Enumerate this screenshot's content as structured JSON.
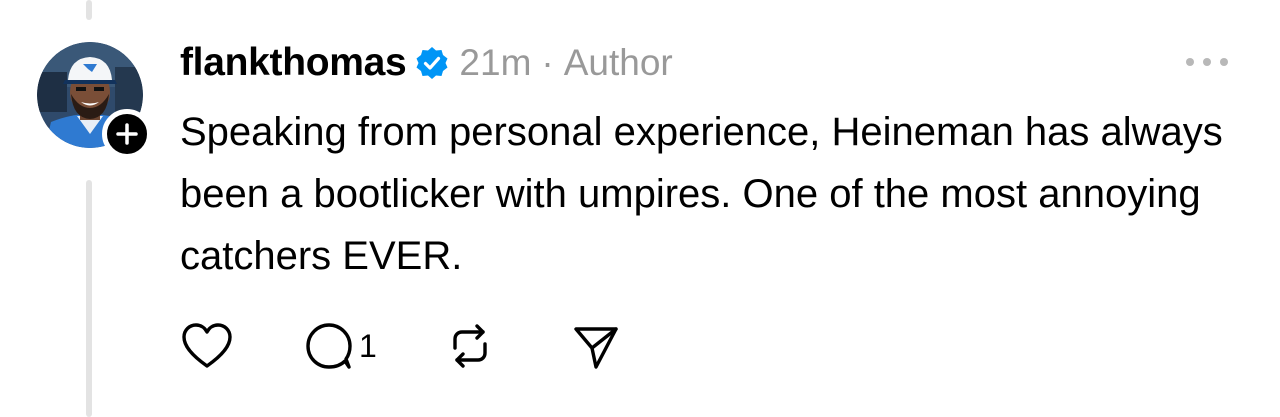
{
  "post": {
    "username": "flankthomas",
    "time": "21m",
    "separator": "·",
    "author_label": "Author",
    "body": "Speaking from personal experience, Heineman has always been a bootlicker with umpires. One of the most annoying catchers EVER.",
    "reply_count": "1"
  },
  "icons": {
    "verified": "verified-check-icon",
    "more": "more-dots-icon",
    "like": "heart-icon",
    "reply": "comment-icon",
    "repost": "repost-icon",
    "share": "send-icon",
    "follow": "plus-icon"
  },
  "colors": {
    "verified": "#0095f6",
    "meta": "#999999",
    "text": "#000000",
    "thread_line": "#e3e3e3"
  }
}
